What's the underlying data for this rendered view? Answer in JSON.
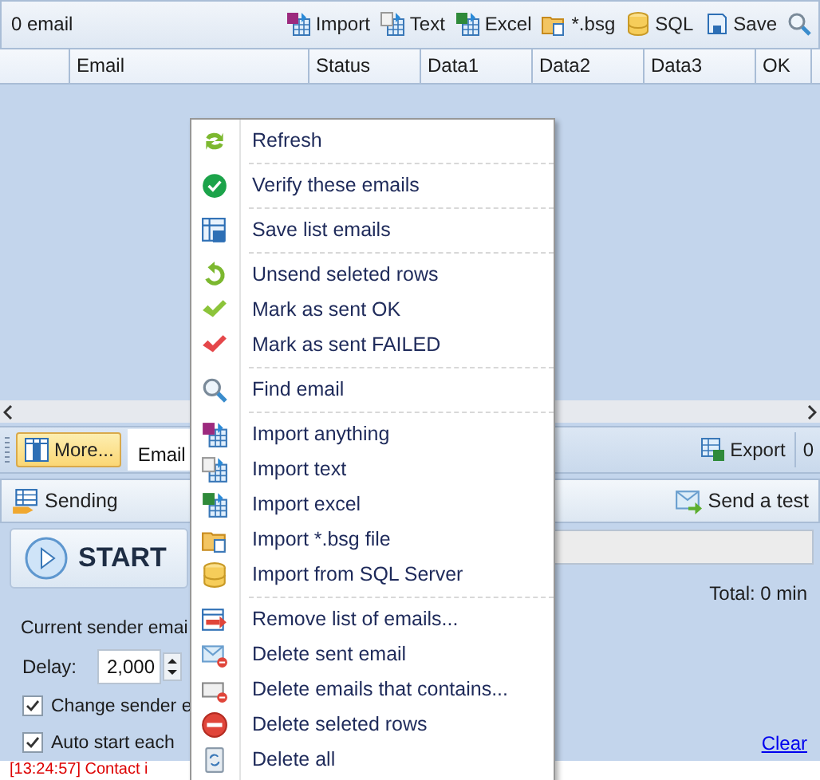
{
  "toolbar": {
    "count": "0 email",
    "buttons": [
      {
        "label": "Import",
        "kind": "import"
      },
      {
        "label": "Text",
        "kind": "text"
      },
      {
        "label": "Excel",
        "kind": "excel"
      },
      {
        "label": "*.bsg",
        "kind": "bsg"
      },
      {
        "label": "SQL",
        "kind": "sql"
      },
      {
        "label": "Save",
        "kind": "save"
      }
    ]
  },
  "grid": {
    "columns": [
      "Email",
      "Status",
      "Data1",
      "Data2",
      "Data3",
      "OK"
    ]
  },
  "bottom_bar": {
    "more_button": "More...",
    "tabs": [
      {
        "label": "Email",
        "selected": true
      }
    ],
    "export_button": "Export",
    "count": "0"
  },
  "sending": {
    "title": "Sending",
    "test_button": "Send a test",
    "start_button": "START",
    "progress": {
      "level": 0
    },
    "total": "Total: 0 min",
    "sender_label": "Current sender emai",
    "delay_label": "Delay:",
    "delay_value": "2,000",
    "options": [
      {
        "label": "Change sender e",
        "checked": true
      },
      {
        "label": "Auto start each",
        "checked": true
      }
    ],
    "clear_link": "Clear",
    "log": "[13:24:57]  Contact i"
  },
  "context_menu": {
    "groups": [
      [
        {
          "label": "Refresh",
          "kind": "refresh"
        }
      ],
      [
        {
          "label": "Verify these emails",
          "kind": "verify"
        }
      ],
      [
        {
          "label": "Save list emails",
          "kind": "savelist"
        }
      ],
      [
        {
          "label": "Unsend seleted rows",
          "kind": "unsend"
        },
        {
          "label": "Mark as sent OK",
          "kind": "ok"
        },
        {
          "label": "Mark as sent FAILED",
          "kind": "failed"
        }
      ],
      [
        {
          "label": "Find email",
          "kind": "find"
        }
      ],
      [
        {
          "label": "Import anything",
          "kind": "import"
        },
        {
          "label": "Import text",
          "kind": "text"
        },
        {
          "label": "Import excel",
          "kind": "excel"
        },
        {
          "label": "Import *.bsg file",
          "kind": "bsg"
        },
        {
          "label": "Import from SQL Server",
          "kind": "sql"
        }
      ],
      [
        {
          "label": "Remove list of emails...",
          "kind": "remove"
        },
        {
          "label": "Delete sent email",
          "kind": "delmail"
        },
        {
          "label": "Delete emails that contains...",
          "kind": "delcontains"
        },
        {
          "label": "Delete seleted rows",
          "kind": "delrows"
        },
        {
          "label": "Delete all",
          "kind": "delall"
        }
      ]
    ]
  }
}
